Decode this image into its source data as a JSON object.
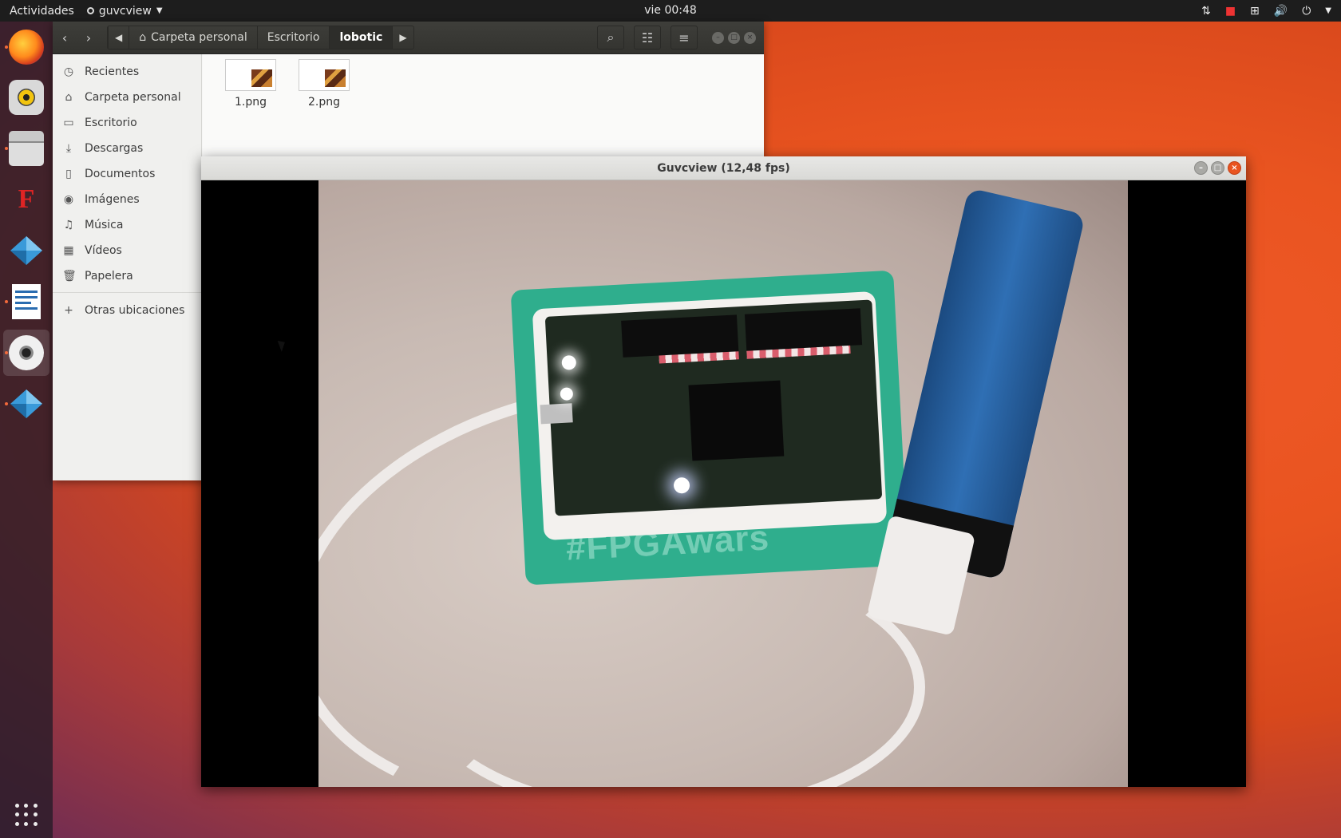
{
  "topbar": {
    "activities": "Actividades",
    "app_menu": "guvcview",
    "clock": "vie 00:48"
  },
  "dock": {
    "items": [
      {
        "name": "firefox",
        "icon": "firefox-icon"
      },
      {
        "name": "rhythmbox",
        "icon": "rhythmbox-icon"
      },
      {
        "name": "files",
        "icon": "files-icon"
      },
      {
        "name": "freecad",
        "icon": "freecad-icon"
      },
      {
        "name": "icestudio",
        "icon": "icestudio-icon"
      },
      {
        "name": "writer",
        "icon": "writer-icon"
      },
      {
        "name": "guvcview",
        "icon": "webcam-icon"
      },
      {
        "name": "icestudio-2",
        "icon": "icestudio-icon"
      }
    ]
  },
  "nautilus": {
    "breadcrumbs": [
      "Carpeta personal",
      "Escritorio",
      "lobotic"
    ],
    "sidebar": [
      {
        "label": "Recientes",
        "icon": "clock-icon"
      },
      {
        "label": "Carpeta personal",
        "icon": "home-icon"
      },
      {
        "label": "Escritorio",
        "icon": "folder-icon"
      },
      {
        "label": "Descargas",
        "icon": "download-icon"
      },
      {
        "label": "Documentos",
        "icon": "document-icon"
      },
      {
        "label": "Imágenes",
        "icon": "camera-icon"
      },
      {
        "label": "Música",
        "icon": "music-icon"
      },
      {
        "label": "Vídeos",
        "icon": "film-icon"
      },
      {
        "label": "Papelera",
        "icon": "trash-icon"
      }
    ],
    "other_locations": "Otras ubicaciones",
    "files": [
      {
        "name": "1.png"
      },
      {
        "name": "2.png"
      }
    ]
  },
  "guvcview": {
    "title": "Guvcview  (12,48 fps)",
    "video_label": "#FPGAwars"
  },
  "colors": {
    "accent": "#e95420",
    "topbar": "#1d1d1d",
    "header": "#3a3a36"
  }
}
